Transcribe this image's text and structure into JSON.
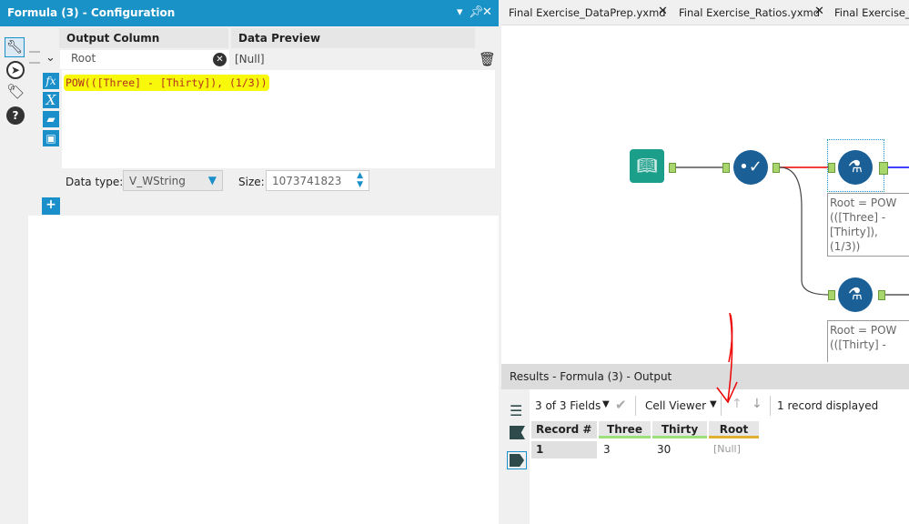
{
  "config_panel": {
    "title": "Formula (3) - Configuration",
    "title_icons": [
      "dropdown-icon",
      "pin-icon",
      "close-icon"
    ],
    "side_icons": [
      "wrench-icon",
      "compass-icon",
      "tag-icon",
      "help-icon"
    ],
    "headers": {
      "output_column": "Output Column",
      "data_preview": "Data Preview"
    },
    "row": {
      "output_column": "Root",
      "preview": "[Null]"
    },
    "expression": "POW(([Three] - [Thirty]), (1/3))",
    "expr_buttons": [
      "fx-icon",
      "variable-icon",
      "open-folder-icon",
      "save-icon"
    ],
    "data_type_label": "Data type:",
    "data_type": "V_WString",
    "size_label": "Size:",
    "size": "1073741823",
    "add_label": "+"
  },
  "tabs": [
    {
      "label": "Final Exercise_DataPrep.yxmd"
    },
    {
      "label": "Final Exercise_Ratios.yxmd"
    },
    {
      "label": "Final Exercise_A"
    }
  ],
  "canvas": {
    "annotation1": [
      "Root = POW",
      "(([Three] -",
      "[Thirty]), (1/3))"
    ],
    "annotation2": [
      "Root = POW",
      "(([Thirty] -"
    ]
  },
  "results": {
    "title": "Results - Formula (3) - Output",
    "fields": "3 of 3 Fields",
    "viewer": "Cell Viewer",
    "records": "1 record displayed",
    "columns": [
      "Record #",
      "Three",
      "Thirty",
      "Root"
    ],
    "rows": [
      [
        "1",
        "3",
        "30",
        "[Null]"
      ]
    ],
    "colors": {
      "numeric": "#9be07a",
      "string": "#e0b030"
    }
  }
}
